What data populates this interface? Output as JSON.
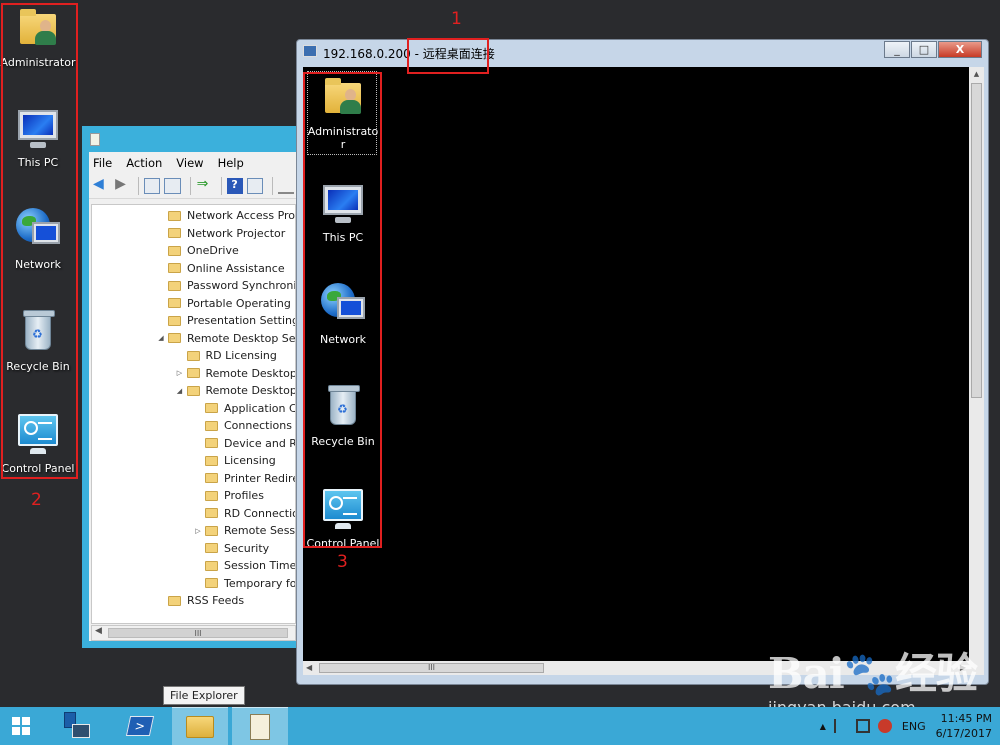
{
  "desktop": {
    "icons": [
      {
        "label": "Administrator"
      },
      {
        "label": "This PC"
      },
      {
        "label": "Network"
      },
      {
        "label": "Recycle Bin"
      },
      {
        "label": "Control Panel"
      }
    ]
  },
  "annotations": {
    "n1": "1",
    "n2": "2",
    "n3": "3"
  },
  "mmc": {
    "menu": [
      "File",
      "Action",
      "View",
      "Help"
    ],
    "tree": [
      {
        "label": "Network Access Prot",
        "indent": 0,
        "twisty": ""
      },
      {
        "label": "Network Projector",
        "indent": 0,
        "twisty": ""
      },
      {
        "label": "OneDrive",
        "indent": 0,
        "twisty": ""
      },
      {
        "label": "Online Assistance",
        "indent": 0,
        "twisty": ""
      },
      {
        "label": "Password Synchroniz",
        "indent": 0,
        "twisty": ""
      },
      {
        "label": "Portable Operating S",
        "indent": 0,
        "twisty": ""
      },
      {
        "label": "Presentation Setting",
        "indent": 0,
        "twisty": ""
      },
      {
        "label": "Remote Desktop Serv",
        "indent": 0,
        "twisty": "◢"
      },
      {
        "label": "RD Licensing",
        "indent": 1,
        "twisty": ""
      },
      {
        "label": "Remote Desktop",
        "indent": 1,
        "twisty": "▷"
      },
      {
        "label": "Remote Desktop",
        "indent": 1,
        "twisty": "◢"
      },
      {
        "label": "Application C",
        "indent": 2,
        "twisty": ""
      },
      {
        "label": "Connections",
        "indent": 2,
        "twisty": ""
      },
      {
        "label": "Device and R",
        "indent": 2,
        "twisty": ""
      },
      {
        "label": "Licensing",
        "indent": 2,
        "twisty": ""
      },
      {
        "label": "Printer Redire",
        "indent": 2,
        "twisty": ""
      },
      {
        "label": "Profiles",
        "indent": 2,
        "twisty": ""
      },
      {
        "label": "RD Connectio",
        "indent": 2,
        "twisty": ""
      },
      {
        "label": "Remote Sessi",
        "indent": 2,
        "twisty": "▷"
      },
      {
        "label": "Security",
        "indent": 2,
        "twisty": ""
      },
      {
        "label": "Session Time",
        "indent": 2,
        "twisty": ""
      },
      {
        "label": "Temporary fo",
        "indent": 2,
        "twisty": ""
      },
      {
        "label": "RSS Feeds",
        "indent": 0,
        "twisty": ""
      }
    ],
    "hscroll_thumb": "III",
    "hscroll_left": "◀"
  },
  "rdp": {
    "title_ip": "192.168.0.200",
    "title_sep": " - ",
    "title_app": "远程桌面连接",
    "btn_min": "_",
    "btn_max": "□",
    "btn_close": "X",
    "remote_icons": [
      {
        "label": "Administrato\nr"
      },
      {
        "label": "This PC"
      },
      {
        "label": "Network"
      },
      {
        "label": "Recycle Bin"
      },
      {
        "label": "Control Panel"
      }
    ],
    "scroll_up": "▲",
    "scroll_down": "▼",
    "scroll_left": "◀",
    "scroll_right": "▶",
    "hthumb": "III"
  },
  "tooltip": "File Explorer",
  "taskbar": {
    "lang": "ENG",
    "time": "11:45 PM",
    "date": "6/17/2017",
    "tray_arrow": "▲"
  },
  "watermark": {
    "brand": "Bai🐾经验",
    "url": "jingyan.baidu.com"
  },
  "colors": {
    "annotation": "#e02020",
    "taskbar": "#3aa8d6"
  }
}
